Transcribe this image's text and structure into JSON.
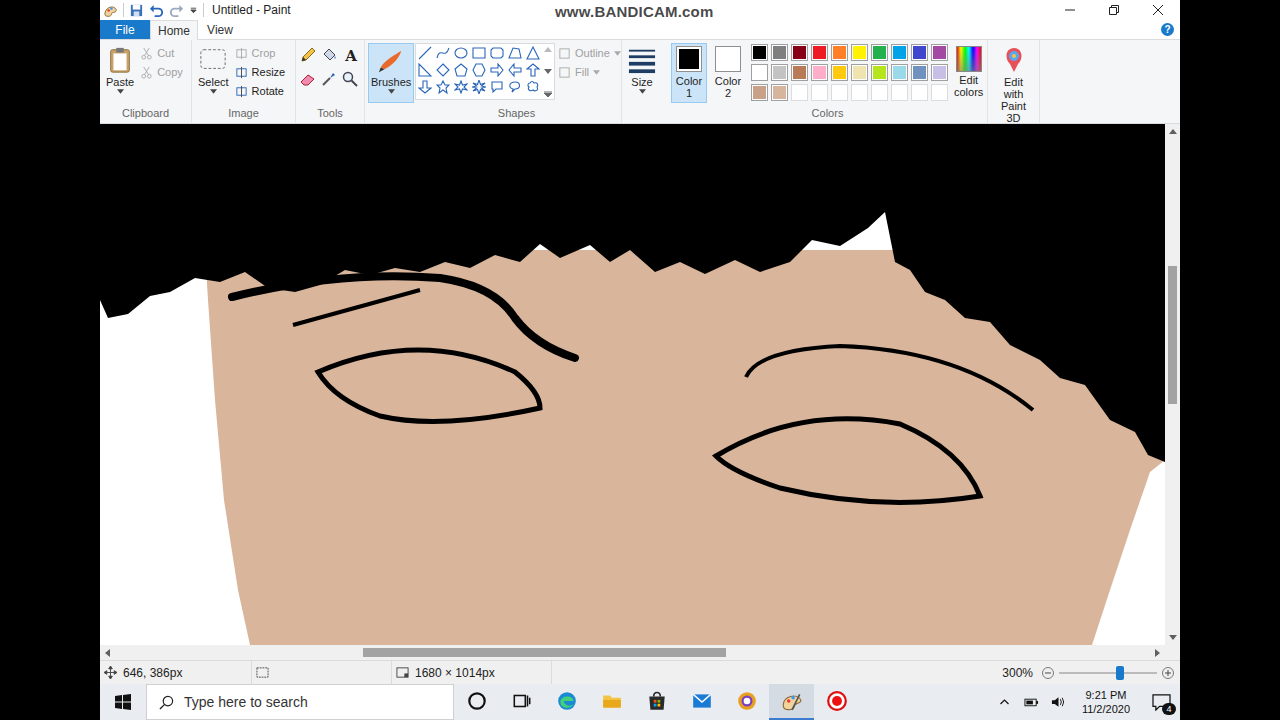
{
  "window": {
    "title": "Untitled - Paint",
    "help": "?"
  },
  "watermark": "www.BANDICAM.com",
  "tabs": [
    {
      "label": "File",
      "kind": "file",
      "selected": false
    },
    {
      "label": "Home",
      "kind": "tab",
      "selected": true
    },
    {
      "label": "View",
      "kind": "tab",
      "selected": false
    }
  ],
  "clipboard": {
    "label": "Clipboard",
    "paste": "Paste",
    "items": [
      {
        "label": "Cut",
        "disabled": true
      },
      {
        "label": "Copy",
        "disabled": true
      }
    ]
  },
  "image": {
    "label": "Image",
    "select": "Select",
    "items": [
      {
        "label": "Crop",
        "disabled": true
      },
      {
        "label": "Resize",
        "disabled": false
      },
      {
        "label": "Rotate",
        "disabled": false
      }
    ]
  },
  "tools": {
    "label": "Tools",
    "text_tool": "A"
  },
  "brushes": {
    "label": "Brushes",
    "selected": true
  },
  "shapes": {
    "label": "Shapes",
    "options": [
      {
        "label": "Outline",
        "disabled": true
      },
      {
        "label": "Fill",
        "disabled": true
      }
    ]
  },
  "size": {
    "label": "Size"
  },
  "colors": {
    "label": "Colors",
    "slots": [
      {
        "label": "Color 1",
        "color": "#000000",
        "selected": true
      },
      {
        "label": "Color 2",
        "color": "#ffffff",
        "selected": false
      }
    ],
    "palette": [
      {
        "color": "#000000",
        "empty": false
      },
      {
        "color": "#7f7f7f",
        "empty": false
      },
      {
        "color": "#880015",
        "empty": false
      },
      {
        "color": "#ed1c24",
        "empty": false
      },
      {
        "color": "#ff7f27",
        "empty": false
      },
      {
        "color": "#fff200",
        "empty": false
      },
      {
        "color": "#22b14c",
        "empty": false
      },
      {
        "color": "#00a2e8",
        "empty": false
      },
      {
        "color": "#3f48cc",
        "empty": false
      },
      {
        "color": "#a349a4",
        "empty": false
      },
      {
        "color": "#ffffff",
        "empty": false
      },
      {
        "color": "#c3c3c3",
        "empty": false
      },
      {
        "color": "#b97a57",
        "empty": false
      },
      {
        "color": "#ffaec9",
        "empty": false
      },
      {
        "color": "#ffc90e",
        "empty": false
      },
      {
        "color": "#efe4b0",
        "empty": false
      },
      {
        "color": "#b5e61d",
        "empty": false
      },
      {
        "color": "#99d9ea",
        "empty": false
      },
      {
        "color": "#7092be",
        "empty": false
      },
      {
        "color": "#c8bfe7",
        "empty": false
      },
      {
        "color": "#c9a088",
        "empty": false
      },
      {
        "color": "#d7b49c",
        "empty": false
      },
      {
        "color": "#ffffff",
        "empty": true
      },
      {
        "color": "#ffffff",
        "empty": true
      },
      {
        "color": "#ffffff",
        "empty": true
      },
      {
        "color": "#ffffff",
        "empty": true
      },
      {
        "color": "#ffffff",
        "empty": true
      },
      {
        "color": "#ffffff",
        "empty": true
      },
      {
        "color": "#ffffff",
        "empty": true
      },
      {
        "color": "#ffffff",
        "empty": true
      }
    ],
    "edit": "Edit colors"
  },
  "paint3d": {
    "label": "Edit with Paint 3D"
  },
  "scrollbars": {
    "horizontal": {
      "start": 0.24,
      "size": 0.35
    },
    "vertical": {
      "start": 0.26,
      "size": 0.28
    }
  },
  "status_bar": {
    "position": "646, 386px",
    "selection": "",
    "size": "1680 × 1014px",
    "zoom": "300%",
    "zoom_level": 0.62
  },
  "taskbar": {
    "search_placeholder": "Type here to search",
    "time": "9:21 PM",
    "date": "11/2/2020",
    "notifications": "4",
    "apps": [
      {
        "kind": "cortana",
        "selected": false
      },
      {
        "kind": "taskview",
        "selected": false
      },
      {
        "kind": "edge",
        "selected": false
      },
      {
        "kind": "explorer",
        "selected": false
      },
      {
        "kind": "store",
        "selected": false
      },
      {
        "kind": "mail",
        "selected": false
      },
      {
        "kind": "chrome",
        "selected": false
      },
      {
        "kind": "paint",
        "selected": true
      },
      {
        "kind": "record",
        "selected": false
      }
    ]
  }
}
